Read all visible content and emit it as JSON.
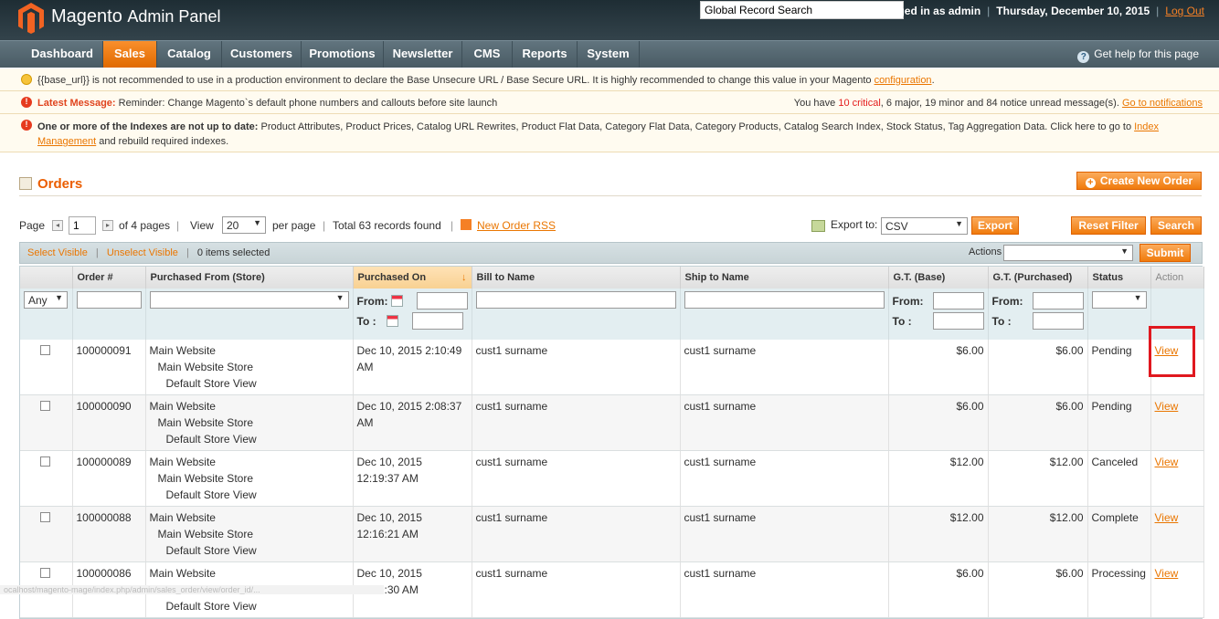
{
  "header": {
    "app_name": "Magento",
    "app_sub": "Admin Panel",
    "global_search_placeholder": "Global Record Search",
    "logged_in": "Logged in as admin",
    "date": "Thursday, December 10, 2015",
    "logout": "Log Out"
  },
  "nav": {
    "items": [
      "Dashboard",
      "Sales",
      "Catalog",
      "Customers",
      "Promotions",
      "Newsletter",
      "CMS",
      "Reports",
      "System"
    ],
    "active": "Sales",
    "help": "Get help for this page"
  },
  "messages": {
    "base_url_prefix": "{{base_url}} is not recommended to use in a production environment to declare the Base Unsecure URL / Base Secure URL. It is highly recommended to change this value in your Magento ",
    "base_url_link": "configuration",
    "base_url_suffix": ".",
    "latest_label": "Latest Message:",
    "latest_text": "Reminder: Change Magento`s default phone numbers and callouts before site launch",
    "notif_prefix": "You have ",
    "notif_critical": "10 critical",
    "notif_mid": ", 6 major, 19 minor and 84 notice unread message(s). ",
    "notif_link": "Go to notifications",
    "index_bold": "One or more of the Indexes are not up to date:",
    "index_text": " Product Attributes, Product Prices, Catalog URL Rewrites, Product Flat Data, Category Flat Data, Category Products, Catalog Search Index, Stock Status, Tag Aggregation Data. Click here to go to ",
    "index_link": "Index Management",
    "index_suffix": " and rebuild required indexes."
  },
  "page": {
    "title": "Orders",
    "create_button": "Create New Order"
  },
  "pager": {
    "page_label": "Page",
    "page_value": "1",
    "of_pages": "of 4 pages",
    "view_label": "View",
    "per_page_value": "20",
    "per_page_label": "per page",
    "total": "Total 63 records found",
    "rss": "New Order RSS",
    "export_label": "Export to:",
    "export_value": "CSV",
    "export_button": "Export",
    "reset_button": "Reset Filter",
    "search_button": "Search"
  },
  "massaction": {
    "select_visible": "Select Visible",
    "unselect_visible": "Unselect Visible",
    "selected": "0 items selected",
    "actions_label": "Actions",
    "submit": "Submit"
  },
  "grid": {
    "columns": [
      "",
      "Order #",
      "Purchased From (Store)",
      "Purchased On",
      "Bill to Name",
      "Ship to Name",
      "G.T. (Base)",
      "G.T. (Purchased)",
      "Status",
      "Action"
    ],
    "filter": {
      "any": "Any",
      "from": "From:",
      "to": "To :"
    },
    "rows": [
      {
        "order": "100000091",
        "store1": "Main Website",
        "store2": "Main Website Store",
        "store3": "Default Store View",
        "date1": "Dec 10, 2015 2:10:49",
        "date2": "AM",
        "bill": "cust1 surname",
        "ship": "cust1 surname",
        "gt_base": "$6.00",
        "gt_purchased": "$6.00",
        "status": "Pending",
        "action": "View"
      },
      {
        "order": "100000090",
        "store1": "Main Website",
        "store2": "Main Website Store",
        "store3": "Default Store View",
        "date1": "Dec 10, 2015 2:08:37",
        "date2": "AM",
        "bill": "cust1 surname",
        "ship": "cust1 surname",
        "gt_base": "$6.00",
        "gt_purchased": "$6.00",
        "status": "Pending",
        "action": "View"
      },
      {
        "order": "100000089",
        "store1": "Main Website",
        "store2": "Main Website Store",
        "store3": "Default Store View",
        "date1": "Dec 10, 2015",
        "date2": "12:19:37 AM",
        "bill": "cust1 surname",
        "ship": "cust1 surname",
        "gt_base": "$12.00",
        "gt_purchased": "$12.00",
        "status": "Canceled",
        "action": "View"
      },
      {
        "order": "100000088",
        "store1": "Main Website",
        "store2": "Main Website Store",
        "store3": "Default Store View",
        "date1": "Dec 10, 2015",
        "date2": "12:16:21 AM",
        "bill": "cust1 surname",
        "ship": "cust1 surname",
        "gt_base": "$12.00",
        "gt_purchased": "$12.00",
        "status": "Complete",
        "action": "View"
      },
      {
        "order": "100000086",
        "store1": "Main Website",
        "store2": "Main Website Store",
        "store3": "Default Store View",
        "date1": "Dec 10, 2015",
        "date2": "12:10:30 AM",
        "bill": "cust1 surname",
        "ship": "cust1 surname",
        "gt_base": "$6.00",
        "gt_purchased": "$6.00",
        "status": "Processing",
        "action": "View"
      }
    ]
  },
  "statusbar": "ocalhost/magento-mage/index.php/admin/sales_order/view/order_id/..."
}
